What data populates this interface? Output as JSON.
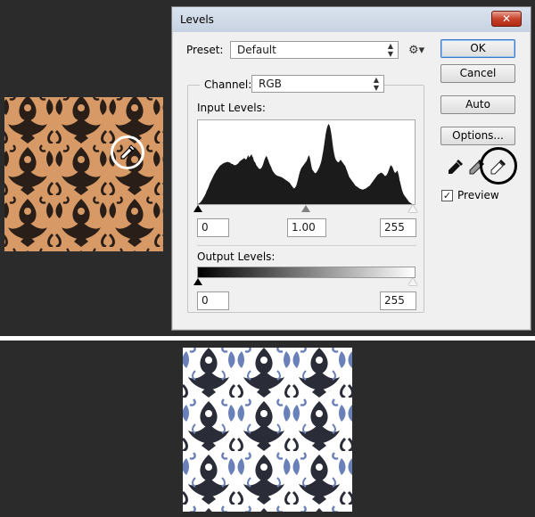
{
  "dialog": {
    "title": "Levels",
    "close_label": "✕",
    "preset_label": "Preset:",
    "preset_value": "Default",
    "channel_label": "Channel:",
    "channel_value": "RGB",
    "input_levels_label": "Input Levels:",
    "input_black": "0",
    "input_gamma": "1.00",
    "input_white": "255",
    "output_levels_label": "Output Levels:",
    "output_black": "0",
    "output_white": "255",
    "buttons": {
      "ok": "OK",
      "cancel": "Cancel",
      "auto": "Auto",
      "options": "Options..."
    },
    "preview_label": "Preview",
    "preview_checked": true,
    "preview_check_glyph": "✓"
  },
  "histogram": [
    0,
    1,
    2,
    3,
    5,
    7,
    9,
    12,
    14,
    17,
    20,
    24,
    27,
    30,
    34,
    38,
    41,
    44,
    47,
    50,
    53,
    56,
    58,
    61,
    63,
    65,
    67,
    69,
    71,
    72,
    73,
    74,
    75,
    76,
    76,
    77,
    77,
    78,
    78,
    77,
    77,
    76,
    75,
    74,
    74,
    73,
    72,
    72,
    72,
    73,
    74,
    75,
    77,
    79,
    80,
    81,
    82,
    83,
    84,
    85,
    83,
    82,
    84,
    88,
    90,
    86,
    88,
    90,
    92,
    88,
    86,
    80,
    78,
    76,
    72,
    70,
    68,
    66,
    65,
    65,
    66,
    68,
    71,
    75,
    80,
    84,
    87,
    89,
    86,
    82,
    78,
    74,
    71,
    68,
    64,
    61,
    59,
    57,
    55,
    54,
    53,
    52,
    52,
    51,
    51,
    50,
    50,
    49,
    48,
    47,
    46,
    45,
    44,
    43,
    42,
    41,
    40,
    38,
    36,
    34,
    32,
    30,
    29,
    30,
    32,
    35,
    40,
    46,
    52,
    58,
    62,
    66,
    68,
    70,
    72,
    74,
    76,
    78,
    80,
    84,
    88,
    90,
    86,
    78,
    70,
    64,
    62,
    60,
    58,
    57,
    58,
    60,
    62,
    65,
    68,
    72,
    76,
    82,
    90,
    98,
    108,
    118,
    128,
    136,
    142,
    146,
    148,
    145,
    140,
    132,
    122,
    110,
    100,
    92,
    86,
    82,
    80,
    78,
    77,
    78,
    80,
    82,
    80,
    78,
    76,
    74,
    72,
    70,
    66,
    62,
    58,
    54,
    50,
    48,
    46,
    44,
    42,
    40,
    38,
    36,
    34,
    33,
    32,
    31,
    30,
    29,
    28,
    28,
    27,
    27,
    27,
    28,
    28,
    29,
    30,
    31,
    32,
    33,
    34,
    36,
    38,
    40,
    42,
    44,
    46,
    48,
    50,
    52,
    54,
    55,
    56,
    57,
    58,
    58,
    57,
    56,
    54,
    52,
    52,
    53,
    55,
    58,
    62,
    66,
    70,
    72,
    70,
    68,
    64,
    60,
    58,
    58,
    60,
    62,
    58,
    52,
    44,
    38,
    32,
    26,
    22,
    18,
    16,
    14,
    12,
    10,
    8,
    6,
    4,
    3,
    2,
    1,
    0,
    0,
    0
  ],
  "colors": {
    "background": "#2b2b2b",
    "swatch_tan": "#d79a66",
    "swatch_pattern": "#2a1f18",
    "result_white": "#ffffff",
    "result_pattern": "#2a2c38",
    "result_accent": "#6a80b8"
  },
  "icons": {
    "gear": "gear-icon",
    "black_point": "black-point-eyedropper-icon",
    "gray_point": "gray-point-eyedropper-icon",
    "white_point": "white-point-eyedropper-icon"
  }
}
